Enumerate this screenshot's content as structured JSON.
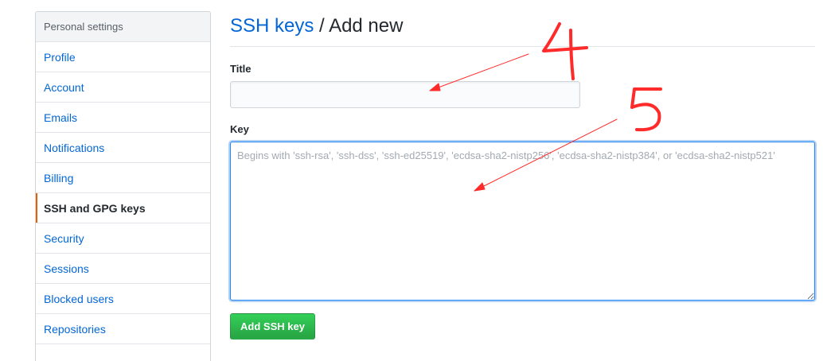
{
  "sidebar": {
    "header": "Personal settings",
    "items": [
      {
        "label": "Profile"
      },
      {
        "label": "Account"
      },
      {
        "label": "Emails"
      },
      {
        "label": "Notifications"
      },
      {
        "label": "Billing"
      },
      {
        "label": "SSH and GPG keys",
        "selected": true
      },
      {
        "label": "Security"
      },
      {
        "label": "Sessions"
      },
      {
        "label": "Blocked users"
      },
      {
        "label": "Repositories"
      }
    ]
  },
  "heading": {
    "link": "SSH keys",
    "separator": "/",
    "current": "Add new"
  },
  "form": {
    "title_label": "Title",
    "title_value": "",
    "key_label": "Key",
    "key_placeholder": "Begins with 'ssh-rsa', 'ssh-dss', 'ssh-ed25519', 'ecdsa-sha2-nistp256', 'ecdsa-sha2-nistp384', or 'ecdsa-sha2-nistp521'",
    "submit_label": "Add SSH key"
  },
  "annotations": {
    "marker_4": "4",
    "marker_5": "5",
    "color": "#ff2a2a"
  },
  "colors": {
    "link": "#0366d6",
    "selected_accent": "#e36209",
    "button_green": "#28a745",
    "focus_border": "#2188ff"
  }
}
